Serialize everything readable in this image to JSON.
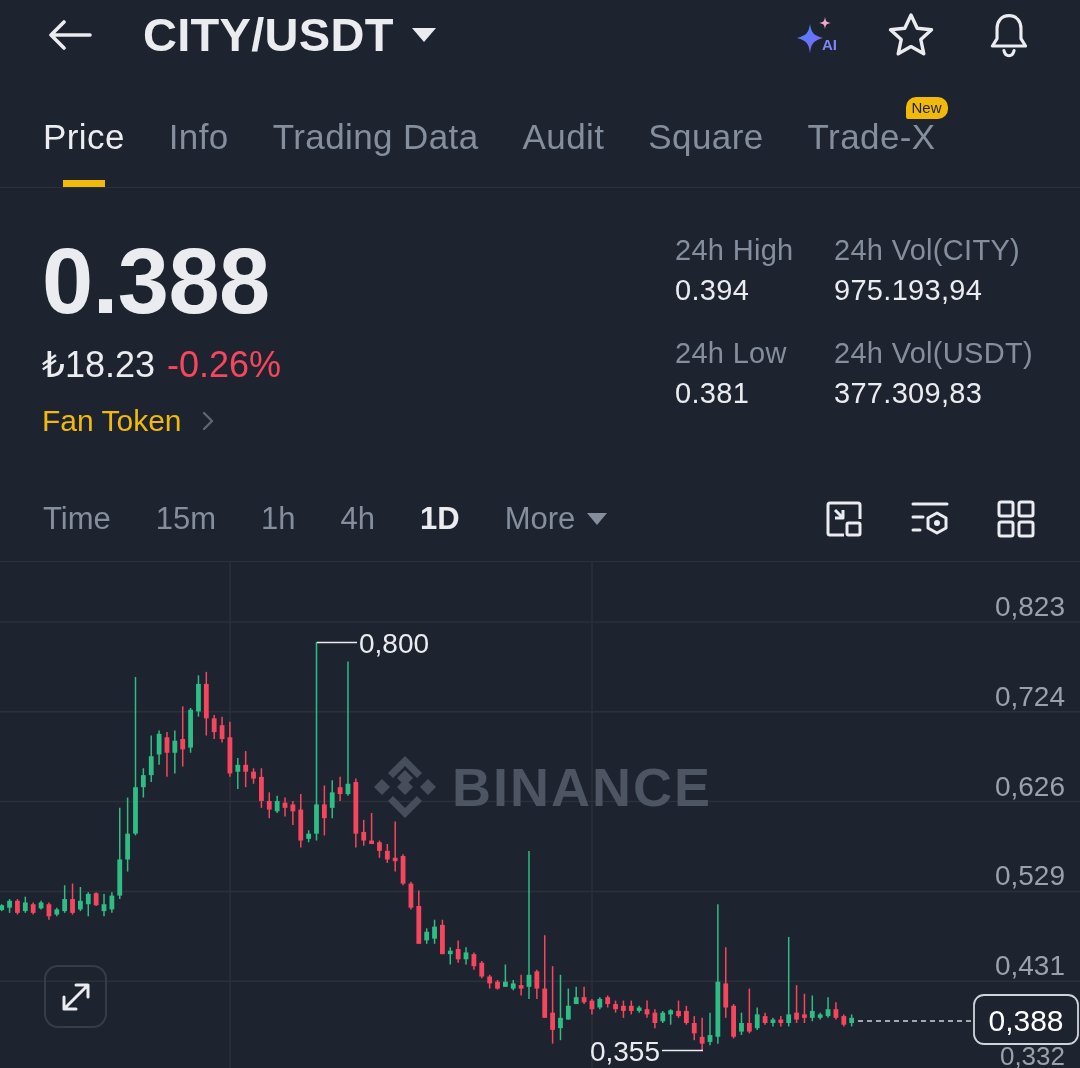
{
  "header": {
    "title": "CITY/USDT",
    "ai_label": "AI"
  },
  "tabs": [
    {
      "label": "Price",
      "selected": true
    },
    {
      "label": "Info",
      "selected": false
    },
    {
      "label": "Trading Data",
      "selected": false
    },
    {
      "label": "Audit",
      "selected": false
    },
    {
      "label": "Square",
      "selected": false
    },
    {
      "label": "Trade-X",
      "selected": false,
      "badge": "New"
    }
  ],
  "ticker": {
    "price": "0.388",
    "local_price": "₺18.23",
    "change": "-0.26%",
    "category": "Fan Token"
  },
  "stats": [
    {
      "label": "24h High",
      "value": "0.394"
    },
    {
      "label": "24h Vol(CITY)",
      "value": "975.193,94"
    },
    {
      "label": "24h Low",
      "value": "0.381"
    },
    {
      "label": "24h Vol(USDT)",
      "value": "377.309,83"
    }
  ],
  "intervals": [
    {
      "label": "Time",
      "kind": "option",
      "selected": false
    },
    {
      "label": "15m",
      "kind": "option",
      "selected": false
    },
    {
      "label": "1h",
      "kind": "option",
      "selected": false
    },
    {
      "label": "4h",
      "kind": "option",
      "selected": false
    },
    {
      "label": "1D",
      "kind": "option",
      "selected": true
    },
    {
      "label": "More",
      "kind": "dropdown",
      "selected": false
    }
  ],
  "chart": {
    "y_axis_labels": [
      "0,823",
      "0,724",
      "0,626",
      "0,529",
      "0,431",
      "0,332"
    ],
    "high_marker": "0,800",
    "low_marker": "0,355",
    "last_price": "0,388",
    "watermark": "BINANCE"
  }
}
